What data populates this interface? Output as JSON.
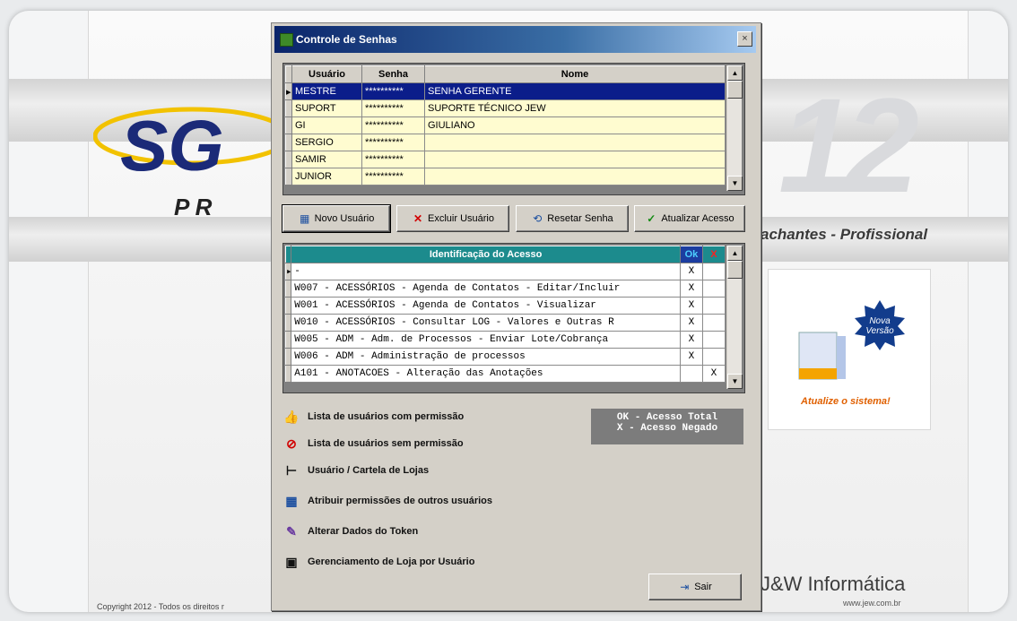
{
  "background": {
    "big_number": "12",
    "logo_letters": "SG",
    "logo_sub": "P R",
    "tagline": "achantes - Profissional",
    "promo": {
      "badge_line1": "Nova",
      "badge_line2": "Versão",
      "cta": "Atualize o sistema!"
    },
    "company_logo": "J&W Informática",
    "company_url": "www.jew.com.br",
    "copyright": "Copyright 2012 - Todos os direitos r"
  },
  "dialog": {
    "title": "Controle de Senhas",
    "close_glyph": "×",
    "users_table": {
      "headers": {
        "user": "Usuário",
        "password": "Senha",
        "name": "Nome"
      },
      "rows": [
        {
          "user": "MESTRE",
          "password": "**********",
          "name": "SENHA GERENTE"
        },
        {
          "user": "SUPORT",
          "password": "**********",
          "name": "SUPORTE TÉCNICO JEW"
        },
        {
          "user": "GI",
          "password": "**********",
          "name": "GIULIANO"
        },
        {
          "user": "SERGIO",
          "password": "**********",
          "name": ""
        },
        {
          "user": "SAMIR",
          "password": "**********",
          "name": ""
        },
        {
          "user": "JUNIOR",
          "password": "**********",
          "name": ""
        }
      ]
    },
    "buttons": {
      "new_user": "Novo Usuário",
      "delete_user": "Excluir Usuário",
      "reset_password": "Resetar Senha",
      "update_access": "Atualizar Acesso"
    },
    "access_table": {
      "headers": {
        "id": "Identificação do Acesso",
        "ok": "Ok",
        "x": "X"
      },
      "rows": [
        {
          "id": "-",
          "ok": "X",
          "x": ""
        },
        {
          "id": "W007 - ACESSÓRIOS - Agenda de Contatos - Editar/Incluir",
          "ok": "X",
          "x": ""
        },
        {
          "id": "W001 - ACESSÓRIOS - Agenda de Contatos - Visualizar",
          "ok": "X",
          "x": ""
        },
        {
          "id": "W010 - ACESSÓRIOS - Consultar LOG - Valores e Outras R",
          "ok": "X",
          "x": ""
        },
        {
          "id": "W005 - ADM - Adm. de Processos - Enviar Lote/Cobrança",
          "ok": "X",
          "x": ""
        },
        {
          "id": "W006 - ADM - Administração de processos",
          "ok": "X",
          "x": ""
        },
        {
          "id": "A101 - ANOTACOES - Alteração das Anotações",
          "ok": "",
          "x": "X"
        }
      ]
    },
    "legend": {
      "line1": "OK - Acesso Total",
      "line2": "X - Acesso Negado"
    },
    "options": [
      {
        "label": "Lista de usuários com permissão",
        "icon": "thumbs-up-icon"
      },
      {
        "label": "Lista de usuários sem permissão",
        "icon": "forbidden-icon"
      },
      {
        "label": "Usuário / Cartela de Lojas",
        "icon": "tree-icon"
      },
      {
        "label": "Atribuir permissões de outros usuários",
        "icon": "users-icon"
      },
      {
        "label": "Alterar Dados do Token",
        "icon": "token-icon"
      },
      {
        "label": "Gerenciamento de Loja por Usuário",
        "icon": "store-icon"
      }
    ],
    "exit_label": "Sair"
  }
}
